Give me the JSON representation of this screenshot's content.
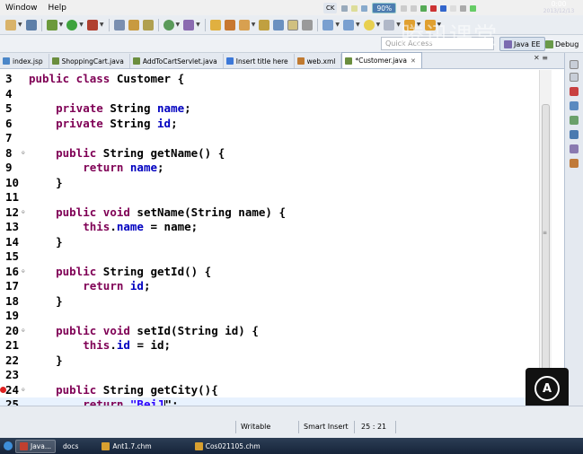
{
  "menu": {
    "items": [
      "Window",
      "Help"
    ]
  },
  "watermark": "腾讯课堂",
  "perspective": {
    "quick_access_placeholder": "Quick Access",
    "java_ee": "Java EE",
    "debug": "Debug"
  },
  "editor_tabs": [
    {
      "label": "index.jsp",
      "active": false,
      "color": "#4a86c8"
    },
    {
      "label": "ShoppingCart.java",
      "active": false,
      "color": "#6b8e3e"
    },
    {
      "label": "AddToCartServlet.java",
      "active": false,
      "color": "#6b8e3e"
    },
    {
      "label": "Insert title here",
      "active": false,
      "color": "#3c78d8"
    },
    {
      "label": "web.xml",
      "active": false,
      "color": "#c07a30"
    },
    {
      "label": "*Customer.java",
      "active": true,
      "color": "#6b8e3e"
    }
  ],
  "tab_controls": "✕  ≡",
  "code": [
    {
      "n": "3",
      "tokens": [
        [
          "kw",
          "public class "
        ],
        [
          "",
          "Customer {"
        ]
      ],
      "fold": false,
      "error": false,
      "current": false
    },
    {
      "n": "4",
      "tokens": [],
      "fold": false,
      "error": false,
      "current": false
    },
    {
      "n": "5",
      "tokens": [
        [
          "",
          "    "
        ],
        [
          "kw",
          "private "
        ],
        [
          "",
          "String "
        ],
        [
          "fld",
          "name"
        ],
        [
          "",
          ";"
        ]
      ],
      "fold": false,
      "error": false,
      "current": false
    },
    {
      "n": "6",
      "tokens": [
        [
          "",
          "    "
        ],
        [
          "kw",
          "private "
        ],
        [
          "",
          "String "
        ],
        [
          "fld",
          "id"
        ],
        [
          "",
          ";"
        ]
      ],
      "fold": false,
      "error": false,
      "current": false
    },
    {
      "n": "7",
      "tokens": [],
      "fold": false,
      "error": false,
      "current": false
    },
    {
      "n": "8",
      "tokens": [
        [
          "",
          "    "
        ],
        [
          "kw",
          "public "
        ],
        [
          "",
          "String getName() {"
        ]
      ],
      "fold": true,
      "error": false,
      "current": false
    },
    {
      "n": "9",
      "tokens": [
        [
          "",
          "        "
        ],
        [
          "kw",
          "return "
        ],
        [
          "fld",
          "name"
        ],
        [
          "",
          ";"
        ]
      ],
      "fold": false,
      "error": false,
      "current": false
    },
    {
      "n": "10",
      "tokens": [
        [
          "",
          "    }"
        ]
      ],
      "fold": false,
      "error": false,
      "current": false
    },
    {
      "n": "11",
      "tokens": [],
      "fold": false,
      "error": false,
      "current": false
    },
    {
      "n": "12",
      "tokens": [
        [
          "",
          "    "
        ],
        [
          "kw",
          "public void "
        ],
        [
          "",
          "setName(String name) {"
        ]
      ],
      "fold": true,
      "error": false,
      "current": false
    },
    {
      "n": "13",
      "tokens": [
        [
          "",
          "        "
        ],
        [
          "kw",
          "this"
        ],
        [
          "",
          "."
        ],
        [
          "fld",
          "name"
        ],
        [
          "",
          " = name;"
        ]
      ],
      "fold": false,
      "error": false,
      "current": false
    },
    {
      "n": "14",
      "tokens": [
        [
          "",
          "    }"
        ]
      ],
      "fold": false,
      "error": false,
      "current": false
    },
    {
      "n": "15",
      "tokens": [],
      "fold": false,
      "error": false,
      "current": false
    },
    {
      "n": "16",
      "tokens": [
        [
          "",
          "    "
        ],
        [
          "kw",
          "public "
        ],
        [
          "",
          "String getId() {"
        ]
      ],
      "fold": true,
      "error": false,
      "current": false
    },
    {
      "n": "17",
      "tokens": [
        [
          "",
          "        "
        ],
        [
          "kw",
          "return "
        ],
        [
          "fld",
          "id"
        ],
        [
          "",
          ";"
        ]
      ],
      "fold": false,
      "error": false,
      "current": false
    },
    {
      "n": "18",
      "tokens": [
        [
          "",
          "    }"
        ]
      ],
      "fold": false,
      "error": false,
      "current": false
    },
    {
      "n": "19",
      "tokens": [],
      "fold": false,
      "error": false,
      "current": false
    },
    {
      "n": "20",
      "tokens": [
        [
          "",
          "    "
        ],
        [
          "kw",
          "public void "
        ],
        [
          "",
          "setId(String id) {"
        ]
      ],
      "fold": true,
      "error": false,
      "current": false
    },
    {
      "n": "21",
      "tokens": [
        [
          "",
          "        "
        ],
        [
          "kw",
          "this"
        ],
        [
          "",
          "."
        ],
        [
          "fld",
          "id"
        ],
        [
          "",
          " = id;"
        ]
      ],
      "fold": false,
      "error": false,
      "current": false
    },
    {
      "n": "22",
      "tokens": [
        [
          "",
          "    }"
        ]
      ],
      "fold": false,
      "error": false,
      "current": false
    },
    {
      "n": "23",
      "tokens": [],
      "fold": false,
      "error": false,
      "current": false
    },
    {
      "n": "24",
      "tokens": [
        [
          "",
          "    "
        ],
        [
          "kw",
          "public "
        ],
        [
          "",
          "String getCity(){"
        ]
      ],
      "fold": true,
      "error": true,
      "current": false
    },
    {
      "n": "25",
      "tokens": [
        [
          "",
          "        "
        ],
        [
          "kw",
          "return "
        ],
        [
          "str",
          "\"BeiJ"
        ],
        [
          "cursor",
          ""
        ],
        [
          "",
          "\";"
        ]
      ],
      "fold": false,
      "error": false,
      "current": true
    }
  ],
  "status": {
    "writable": "Writable",
    "insert_mode": "Smart Insert",
    "position": "25 : 21"
  },
  "float_button": "A",
  "taskbar": {
    "items": [
      {
        "label": "Java...",
        "active": true,
        "color": "#c04030"
      },
      {
        "label": "docs",
        "active": false,
        "color": ""
      },
      {
        "label": "Ant1.7.chm",
        "active": false,
        "color": "#d8a030"
      },
      {
        "label": "Cos021105.chm",
        "active": false,
        "color": "#d8a030"
      }
    ],
    "tray_lang": "CK",
    "zoom": "90%",
    "clock_time": "0:00",
    "clock_date": "2013/12/13"
  },
  "colors": {
    "keyword": "#7f0055",
    "field": "#0000c0",
    "string": "#2a00ff",
    "current_line": "#e8f2fe"
  }
}
